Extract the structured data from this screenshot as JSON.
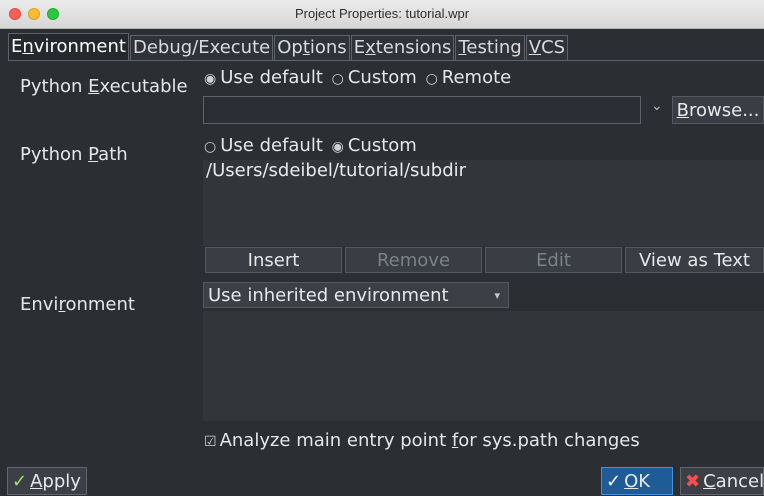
{
  "window": {
    "title": "Project Properties: tutorial.wpr"
  },
  "tabs": [
    {
      "pre": "E",
      "ul": "n",
      "post": "vironment"
    },
    {
      "pre": "Debu",
      "ul": "g",
      "post": "/Execute"
    },
    {
      "pre": "Op",
      "ul": "t",
      "post": "ions"
    },
    {
      "pre": "E",
      "ul": "x",
      "post": "tensions"
    },
    {
      "pre": "",
      "ul": "T",
      "post": "esting"
    },
    {
      "pre": "",
      "ul": "V",
      "post": "CS"
    }
  ],
  "python_executable": {
    "label_pre": "Python ",
    "label_ul": "E",
    "label_post": "xecutable",
    "options": [
      "Use default",
      "Custom",
      "Remote"
    ],
    "selected": "Use default",
    "value": "",
    "browse_label_pre": "",
    "browse_label_ul": "B",
    "browse_label_post": "rowse..."
  },
  "python_path": {
    "label_pre": "Python ",
    "label_ul": "P",
    "label_post": "ath",
    "options": [
      "Use default",
      "Custom"
    ],
    "selected": "Custom",
    "entries": [
      "/Users/sdeibel/tutorial/subdir"
    ],
    "buttons": {
      "insert": "Insert",
      "remove": "Remove",
      "edit": "Edit",
      "view_as_text": "View as Text"
    }
  },
  "environment": {
    "label_pre": "Envi",
    "label_ul": "r",
    "label_post": "onment",
    "selected": "Use inherited environment"
  },
  "analyze": {
    "checked": true,
    "label_pre": "Analyze main entry point ",
    "label_ul": "f",
    "label_post": "or sys.path changes"
  },
  "footer": {
    "apply_ul": "A",
    "apply_post": "pply",
    "ok_ul": "O",
    "ok_post": "K",
    "cancel_ul": "C",
    "cancel_post": "ancel"
  },
  "icons": {
    "radio_on": "◉",
    "radio_off": "○",
    "check_on": "☑",
    "tick": "✓",
    "cross": "✖",
    "chevron": "⌄",
    "dropdown": "▾"
  }
}
